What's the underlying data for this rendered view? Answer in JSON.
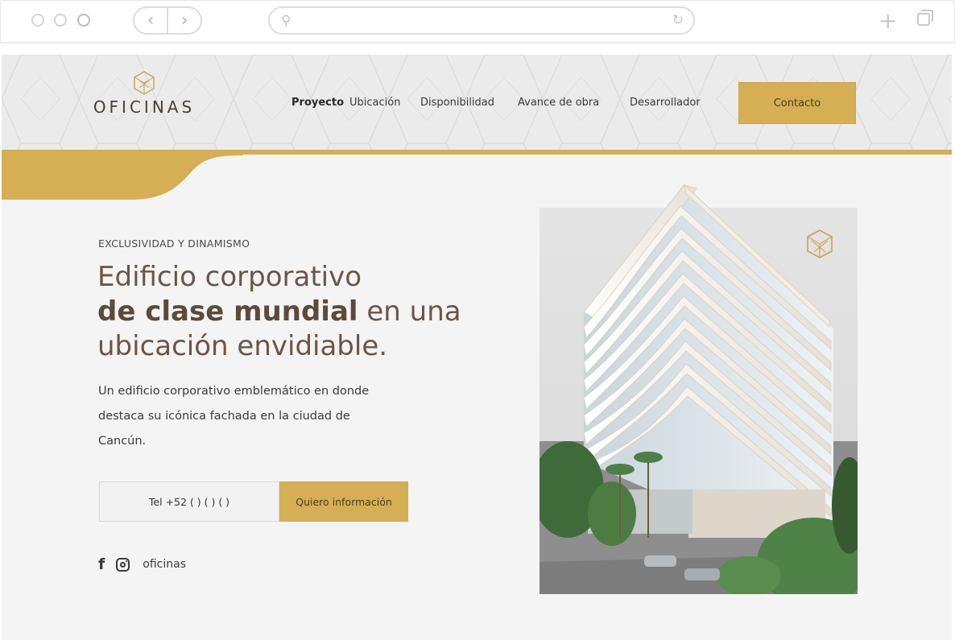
{
  "browser": {
    "back_icon": "chevron-left-icon",
    "forward_icon": "chevron-right-icon",
    "search_icon": "search-icon",
    "reload_icon": "reload-icon",
    "new_tab_icon": "plus-icon",
    "tabs_icon": "tabs-icon"
  },
  "header": {
    "logo_text": "OFICINAS",
    "nav": [
      {
        "label": "Proyecto",
        "active": true
      },
      {
        "label": "Ubicación",
        "active": false
      },
      {
        "label": "Disponibilidad",
        "active": false
      },
      {
        "label": "Avance de obra",
        "active": false
      },
      {
        "label": "Desarrollador",
        "active": false
      }
    ],
    "contact_label": "Contacto"
  },
  "hero": {
    "kicker": "EXCLUSIVIDAD Y DINAMISMO",
    "headline_line1": "Edificio corporativo",
    "headline_bold": "de clase mundial",
    "headline_rest": " en una",
    "headline_line3": "ubicación envidiable.",
    "description": "Un edificio corporativo emblemático en donde destaca su icónica fachada en la ciudad de Cancún.",
    "phone_text": "Tel +52 (      ) (      ) (    )",
    "cta_label": "Quiero información",
    "social_handle": "oficinas"
  },
  "colors": {
    "gold": "#d4af54",
    "brown": "#6a5645",
    "page_bg": "#f4f4f4",
    "header_bg": "#ebebeb"
  }
}
